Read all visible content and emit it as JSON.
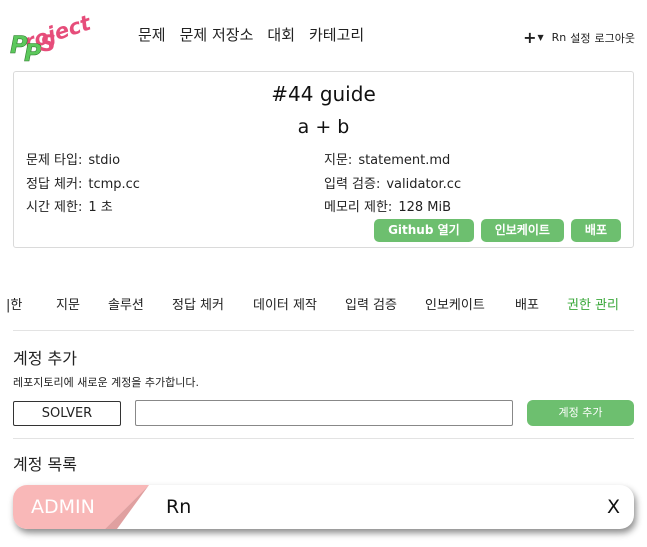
{
  "header": {
    "logo": "Project PS",
    "nav": [
      "문제",
      "문제 저장소",
      "대회",
      "카테고리"
    ],
    "plus_label": "+",
    "user": "Rn",
    "settings": "설정",
    "logout": "로그아웃"
  },
  "problem": {
    "title": "#44 guide",
    "subtitle": "a + b",
    "fields_left": [
      {
        "key": "문제 타입:",
        "value": "stdio"
      },
      {
        "key": "정답 체커:",
        "value": "tcmp.cc"
      },
      {
        "key": "시간 제한:",
        "value": "1 초"
      }
    ],
    "fields_right": [
      {
        "key": "지문:",
        "value": "statement.md"
      },
      {
        "key": "입력 검증:",
        "value": "validator.cc"
      },
      {
        "key": "메모리 제한:",
        "value": "128 MiB"
      }
    ],
    "buttons": {
      "github": "Github 열기",
      "invoke": "인보케이트",
      "deploy": "배포"
    }
  },
  "tabs": [
    "|한",
    "지문",
    "솔루션",
    "정답 체커",
    "데이터 제작",
    "입력 검증",
    "인보케이트",
    "배포",
    "권한 관리"
  ],
  "active_tab": "권한 관리",
  "add_account": {
    "title": "계정 추가",
    "description": "레포지토리에 새로운 계정을 추가합니다.",
    "role": "SOLVER",
    "input_value": "",
    "button": "계정 추가"
  },
  "account_list": {
    "title": "계정 목록",
    "accounts": [
      {
        "role": "ADMIN",
        "name": "Rn",
        "remove": "X"
      }
    ]
  },
  "colors": {
    "accent": "#6dbf6f",
    "active_tab": "#3aa83a",
    "admin_badge": "#f9b8b8",
    "logo_green": "#5cc85c",
    "logo_pink": "#e64d7a"
  }
}
